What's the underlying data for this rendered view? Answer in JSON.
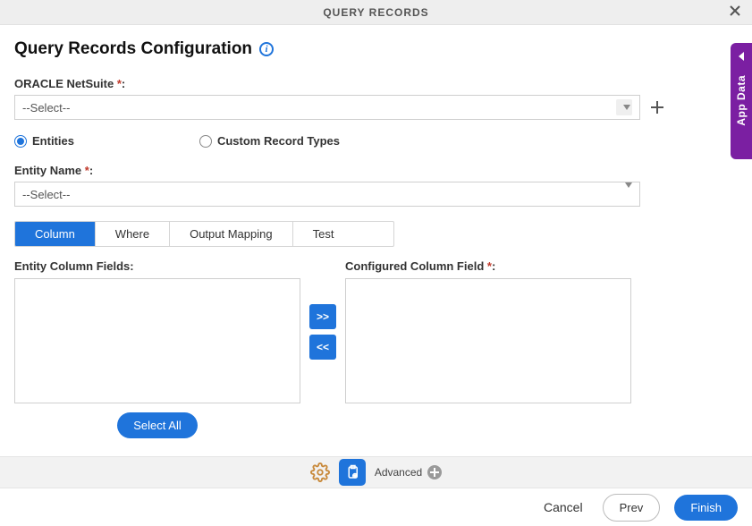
{
  "titlebar": {
    "title": "QUERY RECORDS"
  },
  "heading": "Query Records Configuration",
  "oracle": {
    "label_prefix": "ORACLE NetSuite ",
    "star": "*",
    "colon": ":",
    "selected": "--Select--"
  },
  "record_type": {
    "options": [
      "Entities",
      "Custom Record Types"
    ],
    "selected_index": 0
  },
  "entity_name": {
    "label_prefix": "Entity Name ",
    "star": "*",
    "colon": ":",
    "selected": "--Select--"
  },
  "tabs": {
    "items": [
      "Column",
      "Where",
      "Output Mapping",
      "Test"
    ],
    "active_index": 0
  },
  "dual": {
    "left_label": "Entity Column Fields:",
    "right_label_prefix": "Configured Column Field ",
    "right_star": "*",
    "right_colon": ":",
    "move_right": ">>",
    "move_left": "<<",
    "select_all": "Select All"
  },
  "toolbar": {
    "advanced": "Advanced"
  },
  "footer": {
    "cancel": "Cancel",
    "prev": "Prev",
    "finish": "Finish"
  },
  "sidetab": {
    "label": "App Data"
  }
}
